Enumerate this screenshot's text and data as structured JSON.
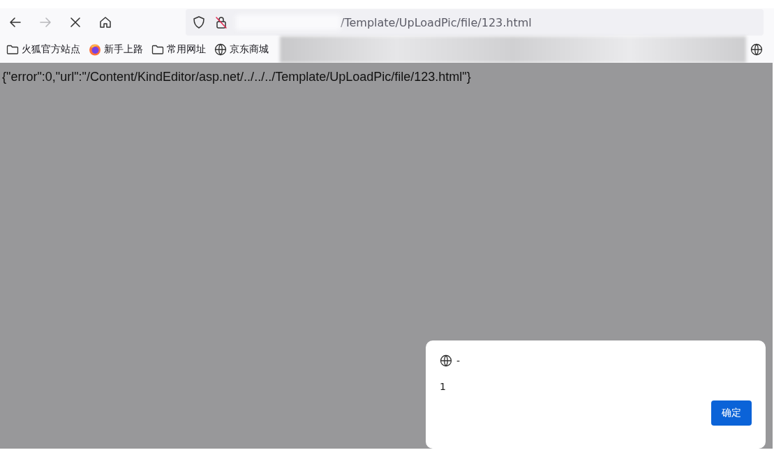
{
  "toolbar": {
    "address": "/Template/UpLoadPic/file/123.html",
    "forward_disabled": true
  },
  "bookmarks": [
    {
      "kind": "folder",
      "label": "火狐官方站点"
    },
    {
      "kind": "firefox",
      "label": "新手上路"
    },
    {
      "kind": "folder",
      "label": "常用网址"
    },
    {
      "kind": "globe",
      "label": "京东商城"
    }
  ],
  "page": {
    "text": "{\"error\":0,\"url\":\"/Content/KindEditor/asp.net/../../../Template/UpLoadPic/file/123.html\"}"
  },
  "dialog": {
    "title": "-",
    "message": "1",
    "button": "确定"
  }
}
